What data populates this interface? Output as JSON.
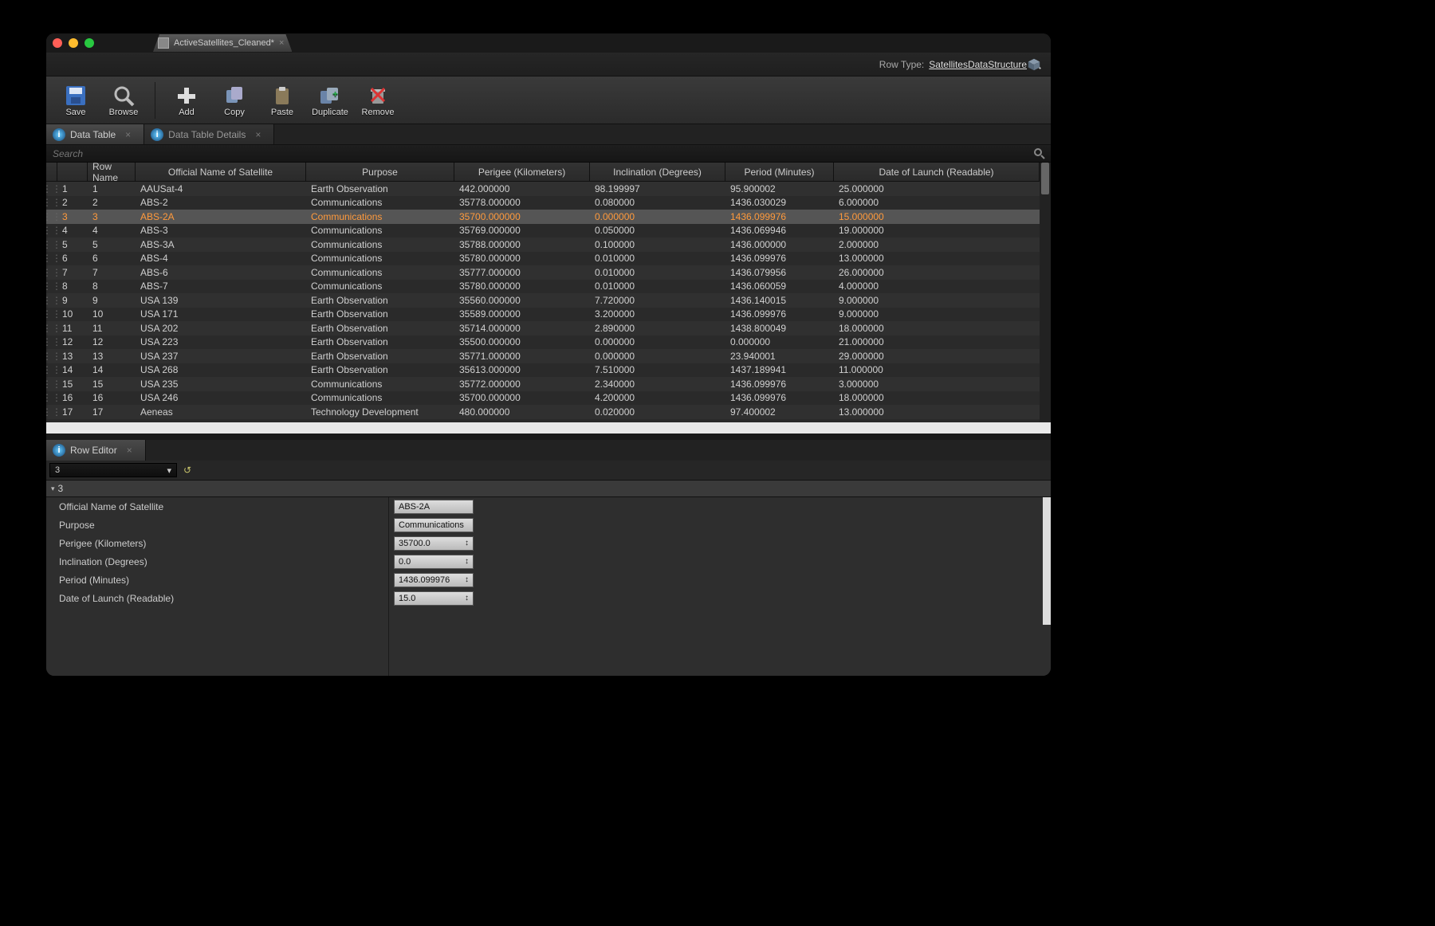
{
  "window": {
    "tab_title": "ActiveSatellites_Cleaned*"
  },
  "rowtype": {
    "label": "Row Type:",
    "value": "SatellitesDataStructure"
  },
  "toolbar": {
    "save": "Save",
    "browse": "Browse",
    "add": "Add",
    "copy": "Copy",
    "paste": "Paste",
    "duplicate": "Duplicate",
    "remove": "Remove"
  },
  "panel_tabs": {
    "data_table": "Data Table",
    "data_table_details": "Data Table Details"
  },
  "search": {
    "placeholder": "Search"
  },
  "grid": {
    "headers": {
      "row_name": "Row Name",
      "official": "Official Name of Satellite",
      "purpose": "Purpose",
      "perigee": "Perigee (Kilometers)",
      "inclination": "Inclination (Degrees)",
      "period": "Period (Minutes)",
      "launch": "Date of Launch (Readable)"
    },
    "selected_index": 2,
    "rows": [
      {
        "idx": "1",
        "name": "1",
        "official": "AAUSat-4",
        "purpose": "Earth Observation",
        "perigee": "442.000000",
        "inclination": "98.199997",
        "period": "95.900002",
        "launch": "25.000000"
      },
      {
        "idx": "2",
        "name": "2",
        "official": "ABS-2",
        "purpose": "Communications",
        "perigee": "35778.000000",
        "inclination": "0.080000",
        "period": "1436.030029",
        "launch": "6.000000"
      },
      {
        "idx": "3",
        "name": "3",
        "official": "ABS-2A",
        "purpose": "Communications",
        "perigee": "35700.000000",
        "inclination": "0.000000",
        "period": "1436.099976",
        "launch": "15.000000"
      },
      {
        "idx": "4",
        "name": "4",
        "official": "ABS-3",
        "purpose": "Communications",
        "perigee": "35769.000000",
        "inclination": "0.050000",
        "period": "1436.069946",
        "launch": "19.000000"
      },
      {
        "idx": "5",
        "name": "5",
        "official": "ABS-3A",
        "purpose": "Communications",
        "perigee": "35788.000000",
        "inclination": "0.100000",
        "period": "1436.000000",
        "launch": "2.000000"
      },
      {
        "idx": "6",
        "name": "6",
        "official": "ABS-4",
        "purpose": "Communications",
        "perigee": "35780.000000",
        "inclination": "0.010000",
        "period": "1436.099976",
        "launch": "13.000000"
      },
      {
        "idx": "7",
        "name": "7",
        "official": "ABS-6",
        "purpose": "Communications",
        "perigee": "35777.000000",
        "inclination": "0.010000",
        "period": "1436.079956",
        "launch": "26.000000"
      },
      {
        "idx": "8",
        "name": "8",
        "official": "ABS-7",
        "purpose": "Communications",
        "perigee": "35780.000000",
        "inclination": "0.010000",
        "period": "1436.060059",
        "launch": "4.000000"
      },
      {
        "idx": "9",
        "name": "9",
        "official": "USA 139",
        "purpose": "Earth Observation",
        "perigee": "35560.000000",
        "inclination": "7.720000",
        "period": "1436.140015",
        "launch": "9.000000"
      },
      {
        "idx": "10",
        "name": "10",
        "official": "USA 171",
        "purpose": "Earth Observation",
        "perigee": "35589.000000",
        "inclination": "3.200000",
        "period": "1436.099976",
        "launch": "9.000000"
      },
      {
        "idx": "11",
        "name": "11",
        "official": "USA 202",
        "purpose": "Earth Observation",
        "perigee": "35714.000000",
        "inclination": "2.890000",
        "period": "1438.800049",
        "launch": "18.000000"
      },
      {
        "idx": "12",
        "name": "12",
        "official": "USA 223",
        "purpose": "Earth Observation",
        "perigee": "35500.000000",
        "inclination": "0.000000",
        "period": "0.000000",
        "launch": "21.000000"
      },
      {
        "idx": "13",
        "name": "13",
        "official": "USA 237",
        "purpose": "Earth Observation",
        "perigee": "35771.000000",
        "inclination": "0.000000",
        "period": "23.940001",
        "launch": "29.000000"
      },
      {
        "idx": "14",
        "name": "14",
        "official": "USA 268",
        "purpose": "Earth Observation",
        "perigee": "35613.000000",
        "inclination": "7.510000",
        "period": "1437.189941",
        "launch": "11.000000"
      },
      {
        "idx": "15",
        "name": "15",
        "official": "USA 235",
        "purpose": "Communications",
        "perigee": "35772.000000",
        "inclination": "2.340000",
        "period": "1436.099976",
        "launch": "3.000000"
      },
      {
        "idx": "16",
        "name": "16",
        "official": "USA 246",
        "purpose": "Communications",
        "perigee": "35700.000000",
        "inclination": "4.200000",
        "period": "1436.099976",
        "launch": "18.000000"
      },
      {
        "idx": "17",
        "name": "17",
        "official": "Aeneas",
        "purpose": "Technology Development",
        "perigee": "480.000000",
        "inclination": "0.020000",
        "period": "97.400002",
        "launch": "13.000000"
      }
    ]
  },
  "row_editor": {
    "tab": "Row Editor",
    "dropdown_value": "3",
    "section_title": "3",
    "fields": {
      "official": {
        "label": "Official Name of Satellite",
        "value": "ABS-2A",
        "type": "text"
      },
      "purpose": {
        "label": "Purpose",
        "value": "Communications",
        "type": "text"
      },
      "perigee": {
        "label": "Perigee (Kilometers)",
        "value": "35700.0",
        "type": "num"
      },
      "inclination": {
        "label": "Inclination (Degrees)",
        "value": "0.0",
        "type": "num"
      },
      "period": {
        "label": "Period (Minutes)",
        "value": "1436.099976",
        "type": "num"
      },
      "launch": {
        "label": "Date of Launch (Readable)",
        "value": "15.0",
        "type": "num"
      }
    }
  }
}
